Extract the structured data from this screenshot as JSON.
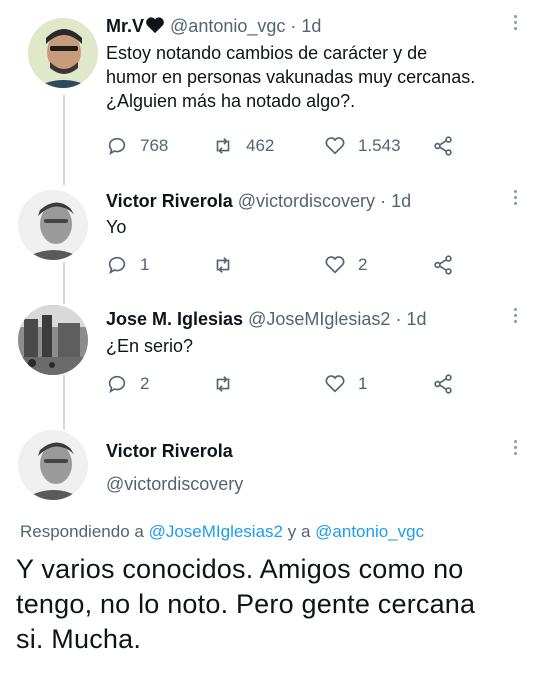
{
  "tweets": [
    {
      "author": "Mr.V",
      "badge_icon": "heart-icon",
      "handle": "@antonio_vgc",
      "dot": "·",
      "time": "1d",
      "text_lines": [
        "Estoy notando cambios de carácter y de",
        "humor en personas vakunadas muy cercanas.",
        "¿Alguien más ha notado algo?."
      ],
      "replies": "768",
      "retweets": "462",
      "likes": "1.543"
    },
    {
      "author": "Victor Riverola",
      "handle": "@victordiscovery",
      "dot": "·",
      "time": "1d",
      "text": "Yo",
      "replies": "1",
      "retweets": "",
      "likes": "2"
    },
    {
      "author": "Jose M. Iglesias",
      "handle": "@JoseMIglesias2",
      "dot": "·",
      "time": "1d",
      "text": "¿En serio?",
      "replies": "2",
      "retweets": "",
      "likes": "1"
    }
  ],
  "main_tweet": {
    "author": "Victor Riverola",
    "handle": "@victordiscovery",
    "replying_prefix": "Respondiendo a",
    "replying_to_1": "@JoseMIglesias2",
    "replying_joiner": "y a",
    "replying_to_2": "@antonio_vgc",
    "text_lines": [
      "Y varios conocidos. Amigos como no",
      "tengo, no lo noto. Pero gente cercana",
      "si. Mucha."
    ]
  },
  "colors": {
    "text": "#0f1419",
    "muted": "#536471",
    "link": "#1d9bf0",
    "thread_line": "#cfd9de"
  }
}
